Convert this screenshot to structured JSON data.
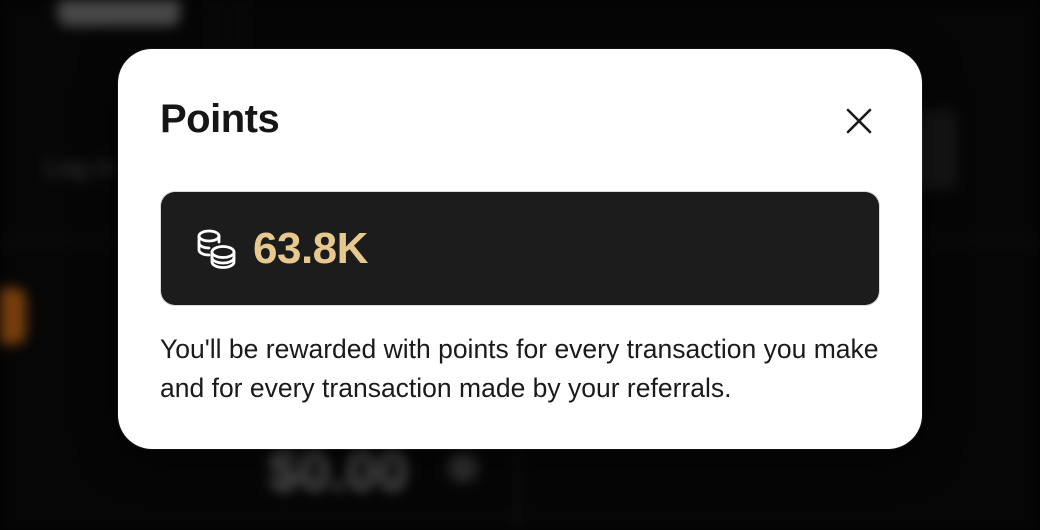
{
  "background": {
    "balance_text": "$0.00",
    "login_text": "Log in"
  },
  "modal": {
    "title": "Points",
    "close_icon": "close-icon",
    "points": {
      "icon": "coins-icon",
      "value": "63.8K",
      "value_color": "#e7c98f",
      "card_color": "#1c1c1c"
    },
    "description": "You'll be rewarded with points for every transaction you make and for every transaction made by your referrals."
  }
}
